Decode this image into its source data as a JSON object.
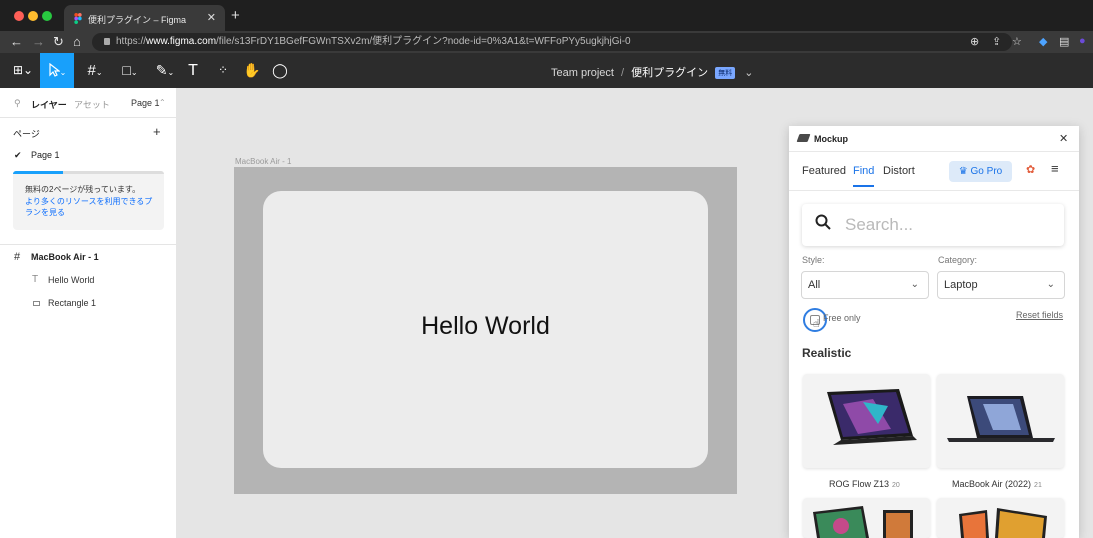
{
  "browser": {
    "tab_title": "便利プラグイン – Figma",
    "new_tab": "+",
    "url_prefix": "https://",
    "url_domain": "www.figma.com",
    "url_path": "/file/s13FrDY1BGefFGWnTSXv2m/便利プラグイン?node-id=0%3A1&t=WFFoPYy5ugkjhjGi-0"
  },
  "figma": {
    "project": "Team project",
    "separator": "/",
    "file_name": "便利プラグイン",
    "badge": "無料",
    "chevron": "⌄"
  },
  "left_panel": {
    "tab_layers": "レイヤー",
    "tab_assets": "アセット",
    "page_selector": "Page 1",
    "pages_heading": "ページ",
    "add": "+",
    "current_page": "Page 1",
    "notice_title": "無料の2ページが残っています。",
    "notice_link": "より多くのリソースを利用できるプランを見る",
    "notice_progress": 0.33,
    "layers": [
      {
        "label": "MacBook Air - 1"
      },
      {
        "label": "Hello World"
      },
      {
        "label": "Rectangle 1"
      }
    ]
  },
  "canvas": {
    "frame_label": "MacBook Air - 1",
    "text": "Hello World"
  },
  "plugin": {
    "title": "Mockup",
    "close": "✕",
    "tabs": [
      "Featured",
      "Find",
      "Distort"
    ],
    "active_tab": "Find",
    "gopro": "Go Pro",
    "search_placeholder": "Search...",
    "style_label": "Style:",
    "style_value": "All",
    "category_label": "Category:",
    "category_value": "Laptop",
    "free_only": "Free only",
    "reset": "Reset fields",
    "section": "Realistic",
    "cards": [
      {
        "name": "ROG Flow Z13",
        "count": "20"
      },
      {
        "name": "MacBook Air (2022)",
        "count": "21"
      }
    ]
  },
  "colors": {
    "accent": "#18a0fb",
    "link": "#1a73e8"
  }
}
